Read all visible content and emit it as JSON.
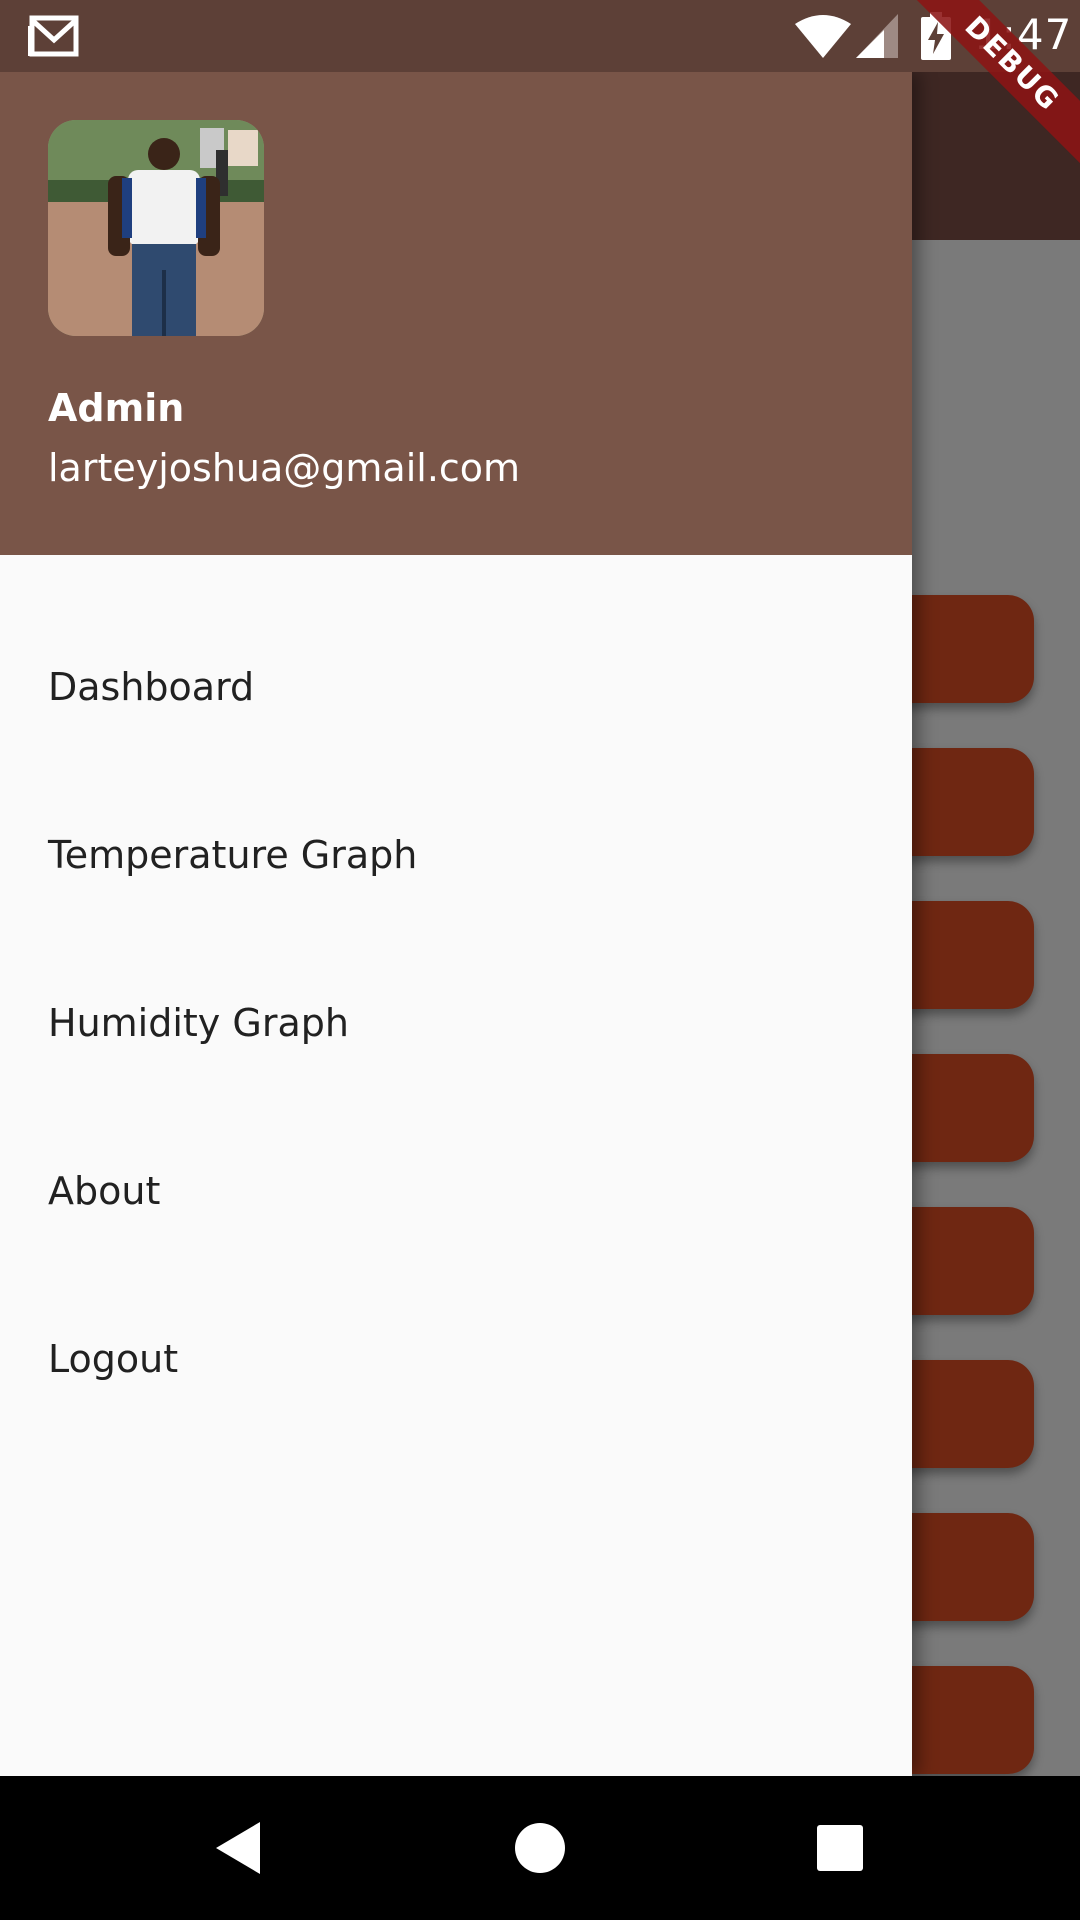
{
  "status_bar": {
    "time": "1:47",
    "icons": [
      "gmail-icon",
      "wifi-icon",
      "cell-signal-icon",
      "battery-charging-icon"
    ]
  },
  "debug_banner": {
    "label": "DEBUG",
    "color": "#8c1414"
  },
  "drawer": {
    "header": {
      "account_name": "Admin",
      "account_email": "larteyjoshua@gmail.com",
      "background_color": "#795548"
    },
    "menu": [
      {
        "label": "Dashboard"
      },
      {
        "label": "Temperature Graph"
      },
      {
        "label": "Humidity Graph"
      },
      {
        "label": "About"
      },
      {
        "label": "Logout"
      }
    ]
  },
  "colors": {
    "status_bar": "#5d4037",
    "app_bar": "#3e2723",
    "card": "#6f2712",
    "drawer_background": "#fafafa"
  },
  "navigation_bar": {
    "buttons": [
      "back-icon",
      "home-icon",
      "recents-icon"
    ]
  }
}
